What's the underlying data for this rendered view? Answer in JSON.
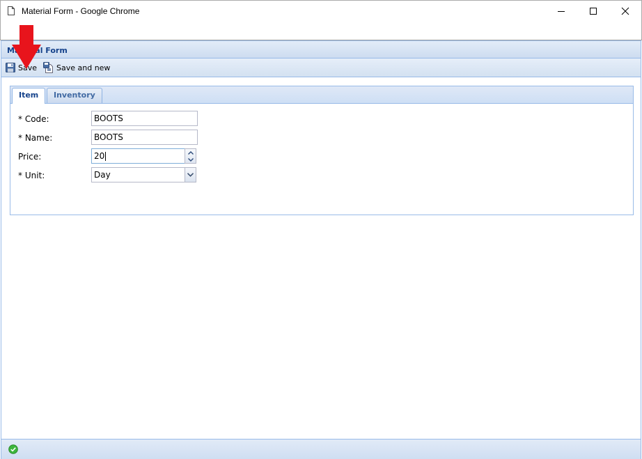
{
  "window": {
    "title": "Material Form - Google Chrome"
  },
  "panel": {
    "title": "Material Form"
  },
  "toolbar": {
    "save_label": "Save",
    "save_new_label": "Save and new"
  },
  "tabs": [
    {
      "label": "Item",
      "active": true
    },
    {
      "label": "Inventory",
      "active": false
    }
  ],
  "form": {
    "code": {
      "label": "* Code:",
      "value": "BOOTS"
    },
    "name": {
      "label": "* Name:",
      "value": "BOOTS"
    },
    "price": {
      "label": "Price:",
      "value": "20"
    },
    "unit": {
      "label": "* Unit:",
      "value": "Day"
    }
  },
  "status": {
    "icon": "check-circle-icon"
  },
  "colors": {
    "accent": "#15428b",
    "border": "#99bbe8",
    "annotation_arrow": "#e8141c",
    "status_ok": "#3db63d"
  }
}
